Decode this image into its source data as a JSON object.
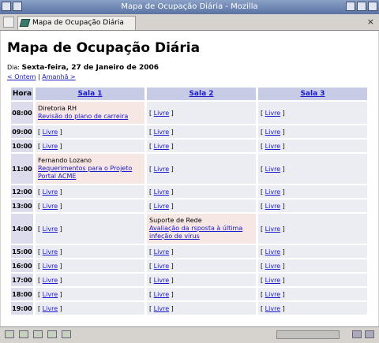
{
  "window": {
    "title": "Mapa de Ocupação Diária - Mozilla"
  },
  "tab": {
    "label": "Mapa de Ocupação Diária",
    "close": "×"
  },
  "page": {
    "heading": "Mapa de Ocupação Diária",
    "day_label": "Dia:",
    "day_value": "Sexta-feira, 27 de Janeiro de 2006",
    "prev_link": "< Ontem",
    "separator": "|",
    "next_link": "Amanhã >"
  },
  "table": {
    "hour_header": "Hora",
    "rooms": [
      "Sala 1",
      "Sala 2",
      "Sala 3"
    ],
    "free_label": "Livre",
    "rows": [
      {
        "hour": "08:00",
        "cells": [
          {
            "busy": true,
            "who": "Diretoria RH",
            "what": "Revisão do plano de carreira"
          },
          {
            "busy": false
          },
          {
            "busy": false
          }
        ]
      },
      {
        "hour": "09:00",
        "cells": [
          {
            "busy": false
          },
          {
            "busy": false
          },
          {
            "busy": false
          }
        ]
      },
      {
        "hour": "10:00",
        "cells": [
          {
            "busy": false
          },
          {
            "busy": false
          },
          {
            "busy": false
          }
        ]
      },
      {
        "hour": "11:00",
        "cells": [
          {
            "busy": true,
            "who": "Fernando Lozano",
            "what": "Requerimentos para o Projeto Portal ACME"
          },
          {
            "busy": false
          },
          {
            "busy": false
          }
        ]
      },
      {
        "hour": "12:00",
        "cells": [
          {
            "busy": false
          },
          {
            "busy": false
          },
          {
            "busy": false
          }
        ]
      },
      {
        "hour": "13:00",
        "cells": [
          {
            "busy": false
          },
          {
            "busy": false
          },
          {
            "busy": false
          }
        ]
      },
      {
        "hour": "14:00",
        "cells": [
          {
            "busy": false
          },
          {
            "busy": true,
            "who": "Suporte de Rede",
            "what": "Avaliação da rsposta à última infeção de vírus"
          },
          {
            "busy": false
          }
        ]
      },
      {
        "hour": "15:00",
        "cells": [
          {
            "busy": false
          },
          {
            "busy": false
          },
          {
            "busy": false
          }
        ]
      },
      {
        "hour": "16:00",
        "cells": [
          {
            "busy": false
          },
          {
            "busy": false
          },
          {
            "busy": false
          }
        ]
      },
      {
        "hour": "17:00",
        "cells": [
          {
            "busy": false
          },
          {
            "busy": false
          },
          {
            "busy": false
          }
        ]
      },
      {
        "hour": "18:00",
        "cells": [
          {
            "busy": false
          },
          {
            "busy": false
          },
          {
            "busy": false
          }
        ]
      },
      {
        "hour": "19:00",
        "cells": [
          {
            "busy": false
          },
          {
            "busy": false
          },
          {
            "busy": false
          }
        ]
      }
    ]
  },
  "colors": {
    "link": "#1a1acc",
    "header_bg": "#c7cbe6",
    "busy_bg": "#f6e6e4",
    "free_bg": "#ececf3"
  },
  "statusbar": {
    "icons": [
      "navigator-icon",
      "mail-icon",
      "composer-icon",
      "address-book-icon",
      "irc-icon"
    ]
  }
}
